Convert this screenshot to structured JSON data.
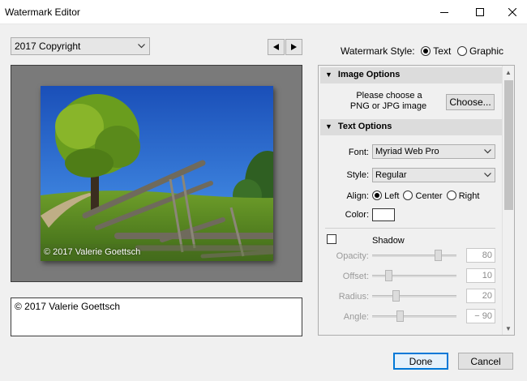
{
  "window": {
    "title": "Watermark Editor"
  },
  "preset": {
    "selected": "2017 Copyright"
  },
  "preview": {
    "watermark_text": "© 2017 Valerie Goettsch"
  },
  "text_input": {
    "value": "© 2017 Valerie Goettsch"
  },
  "watermark_style": {
    "label": "Watermark Style:",
    "options": [
      "Text",
      "Graphic"
    ],
    "selected": "Text"
  },
  "image_options": {
    "header": "Image Options",
    "prompt_line1": "Please choose a",
    "prompt_line2": "PNG or JPG image",
    "choose_label": "Choose..."
  },
  "text_options": {
    "header": "Text Options",
    "font_label": "Font:",
    "font_value": "Myriad Web Pro",
    "style_label": "Style:",
    "style_value": "Regular",
    "align_label": "Align:",
    "align_options": [
      "Left",
      "Center",
      "Right"
    ],
    "align_selected": "Left",
    "color_label": "Color:",
    "color_value": "#ffffff"
  },
  "shadow": {
    "label": "Shadow",
    "enabled": false,
    "opacity_label": "Opacity:",
    "opacity_value": "80",
    "offset_label": "Offset:",
    "offset_value": "10",
    "radius_label": "Radius:",
    "radius_value": "20",
    "angle_label": "Angle:",
    "angle_value": "− 90"
  },
  "actions": {
    "done_label": "Done",
    "cancel_label": "Cancel"
  },
  "colors": {
    "accent": "#0078d7",
    "section_header_bg": "#dcdcdc",
    "preview_bg": "#7a7a7a"
  }
}
